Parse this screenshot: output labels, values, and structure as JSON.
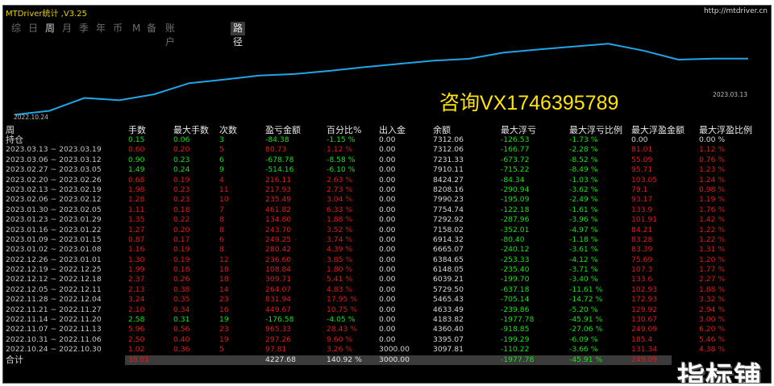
{
  "app": {
    "title": "MTDriver统计 ,V3.25",
    "url": "http://mtdriver.cn"
  },
  "tabs": [
    {
      "label": "综",
      "active": false
    },
    {
      "label": "日",
      "active": false
    },
    {
      "label": "周",
      "active": true
    },
    {
      "label": "月",
      "active": false
    },
    {
      "label": "季",
      "active": false
    },
    {
      "label": "年",
      "active": false
    },
    {
      "label": "币",
      "active": false
    },
    {
      "label": "M",
      "active": false
    },
    {
      "label": "备",
      "active": false
    },
    {
      "label": "账户",
      "active": false
    },
    {
      "label": "路径",
      "active": false
    }
  ],
  "chart_data": {
    "type": "line",
    "x_start_label": "2022.10.24",
    "x_end_label": "2023.03.13",
    "series": [
      {
        "values": [
          3097.81,
          3395.07,
          4360.4,
          4183.82,
          4633.49,
          5465.43,
          5729.5,
          6039.21,
          6148.05,
          6384.65,
          6665.07,
          6914.32,
          7158.02,
          7292.92,
          7754.74,
          7990.23,
          8208.16,
          8424.27,
          7910.11,
          7231.33,
          7312.06,
          7312.06
        ]
      }
    ],
    "line_color": "#1fa6e6"
  },
  "watermark": "咨询VX1746395789",
  "stamp": "指标铺",
  "table": {
    "headers": [
      "周",
      "手数",
      "最大手数",
      "次数",
      "盈亏金额",
      "百分比%",
      "出入金",
      "余额",
      "最大浮亏",
      "最大浮亏比例",
      "最大浮盈金额",
      "最大浮盈比例"
    ],
    "position_row": {
      "label": "持仓",
      "cells": [
        "0.15",
        "0.06",
        "3",
        "-84.38",
        "-1.15 %",
        "0.00",
        "7312.06",
        "-126.53",
        "-1.73 %",
        "0.00",
        "0.00 %"
      ]
    },
    "rows": [
      {
        "week": "2023.03.13 ~ 2023.03.19",
        "cells": [
          "0.60",
          "0.20",
          "5",
          "80.73",
          "1.12 %",
          "0.00",
          "7312.06",
          "-166.77",
          "-2.28 %",
          "81.01",
          "1.12 %"
        ],
        "tone": "red"
      },
      {
        "week": "2023.03.06 ~ 2023.03.12",
        "cells": [
          "0.90",
          "0.23",
          "6",
          "-678.78",
          "-8.58 %",
          "0.00",
          "7231.33",
          "-673.72",
          "-8.52 %",
          "55.09",
          "0.76 %"
        ],
        "tone": "green"
      },
      {
        "week": "2023.02.27 ~ 2023.03.05",
        "cells": [
          "1.49",
          "0.24",
          "9",
          "-514.16",
          "-6.10 %",
          "0.00",
          "7910.11",
          "-715.22",
          "-8.49 %",
          "95.71",
          "1.23 %"
        ],
        "tone": "green"
      },
      {
        "week": "2023.02.20 ~ 2023.02.26",
        "cells": [
          "0.68",
          "0.19",
          "4",
          "216.11",
          "2.63 %",
          "0.00",
          "8424.27",
          "-84.34",
          "-1.03 %",
          "103.05",
          "1.24 %"
        ],
        "tone": "red"
      },
      {
        "week": "2023.02.13 ~ 2023.02.19",
        "cells": [
          "1.98",
          "0.23",
          "11",
          "217.93",
          "2.73 %",
          "0.00",
          "8208.16",
          "-290.94",
          "-3.62 %",
          "79.1",
          "0.98 %"
        ],
        "tone": "red"
      },
      {
        "week": "2023.02.06 ~ 2023.02.12",
        "cells": [
          "1.28",
          "0.23",
          "10",
          "235.49",
          "3.04 %",
          "0.00",
          "7990.23",
          "-195.09",
          "-2.49 %",
          "93.17",
          "1.19 %"
        ],
        "tone": "red"
      },
      {
        "week": "2023.01.30 ~ 2023.02.05",
        "cells": [
          "1.11",
          "0.18",
          "7",
          "461.82",
          "6.33 %",
          "0.00",
          "7754.74",
          "-122.18",
          "-1.61 %",
          "133.9",
          "1.76 %"
        ],
        "tone": "red"
      },
      {
        "week": "2023.01.23 ~ 2023.01.29",
        "cells": [
          "1.35",
          "0.22",
          "8",
          "134.80",
          "1.88 %",
          "0.00",
          "7292.92",
          "-287.96",
          "-3.96 %",
          "101.91",
          "1.42 %"
        ],
        "tone": "red"
      },
      {
        "week": "2023.01.16 ~ 2023.01.22",
        "cells": [
          "1.27",
          "0.20",
          "8",
          "243.70",
          "3.52 %",
          "0.00",
          "7158.02",
          "-352.01",
          "-4.97 %",
          "84.21",
          "1.22 %"
        ],
        "tone": "red"
      },
      {
        "week": "2023.01.09 ~ 2023.01.15",
        "cells": [
          "0.87",
          "0.17",
          "6",
          "249.25",
          "3.74 %",
          "0.00",
          "6914.32",
          "-80.40",
          "-1.18 %",
          "83.28",
          "1.22 %"
        ],
        "tone": "red"
      },
      {
        "week": "2023.01.02 ~ 2023.01.08",
        "cells": [
          "1.16",
          "0.19",
          "8",
          "280.42",
          "4.39 %",
          "0.00",
          "6665.07",
          "-240.12",
          "-3.61 %",
          "83.39",
          "1.31 %"
        ],
        "tone": "red"
      },
      {
        "week": "2022.12.26 ~ 2023.01.01",
        "cells": [
          "1.30",
          "0.19",
          "12",
          "236.60",
          "3.85 %",
          "0.00",
          "6384.65",
          "-253.33",
          "-4.12 %",
          "75.69",
          "1.20 %"
        ],
        "tone": "red"
      },
      {
        "week": "2022.12.19 ~ 2022.12.25",
        "cells": [
          "1.99",
          "0.18",
          "18",
          "108.84",
          "1.80 %",
          "0.00",
          "6148.05",
          "-235.40",
          "-3.71 %",
          "107.3",
          "1.77 %"
        ],
        "tone": "red"
      },
      {
        "week": "2022.12.12 ~ 2022.12.18",
        "cells": [
          "2.37",
          "0.26",
          "18",
          "309.71",
          "5.41 %",
          "0.00",
          "6039.21",
          "-199.70",
          "-3.40 %",
          "133.6",
          "2.27 %"
        ],
        "tone": "red"
      },
      {
        "week": "2022.12.05 ~ 2022.12.11",
        "cells": [
          "2.13",
          "0.38",
          "14",
          "264.07",
          "4.83 %",
          "0.00",
          "5729.50",
          "-637.18",
          "-11.61 %",
          "102.93",
          "1.88 %"
        ],
        "tone": "red"
      },
      {
        "week": "2022.11.28 ~ 2022.12.04",
        "cells": [
          "3.24",
          "0.35",
          "23",
          "831.94",
          "17.95 %",
          "0.00",
          "5465.43",
          "-705.14",
          "-14.72 %",
          "172.93",
          "3.32 %"
        ],
        "tone": "red"
      },
      {
        "week": "2022.11.21 ~ 2022.11.27",
        "cells": [
          "2.10",
          "0.34",
          "16",
          "449.67",
          "10.75 %",
          "0.00",
          "4633.49",
          "-239.86",
          "-5.20 %",
          "129.92",
          "2.94 %"
        ],
        "tone": "red"
      },
      {
        "week": "2022.11.14 ~ 2022.11.20",
        "cells": [
          "2.58",
          "0.31",
          "19",
          "-176.58",
          "-4.05 %",
          "0.00",
          "4183.82",
          "-1977.78",
          "-45.91 %",
          "130.67",
          "3.00 %"
        ],
        "tone": "green"
      },
      {
        "week": "2022.11.07 ~ 2022.11.13",
        "cells": [
          "5.96",
          "0.56",
          "23",
          "965.33",
          "28.43 %",
          "0.00",
          "4360.40",
          "-918.85",
          "-27.06 %",
          "249.09",
          "6.20 %"
        ],
        "tone": "red"
      },
      {
        "week": "2022.10.31 ~ 2022.11.06",
        "cells": [
          "2.50",
          "0.40",
          "19",
          "297.26",
          "9.60 %",
          "0.00",
          "3395.07",
          "-199.29",
          "-6.09 %",
          "185.4",
          "5.46 %"
        ],
        "tone": "red"
      },
      {
        "week": "2022.10.24 ~ 2022.10.30",
        "cells": [
          "1.02",
          "0.36",
          "5",
          "97.81",
          "3.26 %",
          "3000.00",
          "3097.81",
          "-110.22",
          "-3.66 %",
          "131.34",
          "4.38 %"
        ],
        "tone": "red"
      }
    ],
    "total_row": {
      "label": "合计",
      "cells": [
        "38.01",
        "",
        "",
        "4227.68",
        "140.92 %",
        "3000.00",
        "",
        "-1977.78",
        "-45.91 %",
        "249.09",
        ""
      ]
    }
  }
}
